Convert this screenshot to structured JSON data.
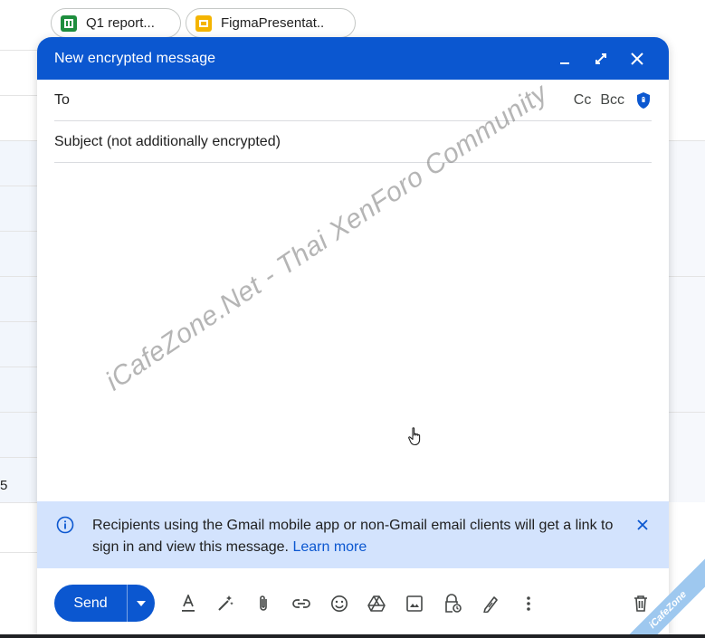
{
  "attachments": [
    {
      "name": "Q1 report...",
      "icon": "sheets-icon"
    },
    {
      "name": "FigmaPresentat..",
      "icon": "slides-icon"
    }
  ],
  "compose": {
    "title": "New encrypted message",
    "to_label": "To",
    "cc_label": "Cc",
    "bcc_label": "Bcc",
    "subject_placeholder": "Subject (not additionally encrypted)"
  },
  "watermark": "iCafeZone.Net - Thai XenForo Community",
  "info_banner": {
    "text": "Recipients using the Gmail mobile app or non-Gmail email clients will get a link to sign in and view this message.",
    "link": "Learn more"
  },
  "toolbar": {
    "send_label": "Send"
  },
  "background": {
    "partial_number": "5"
  },
  "corner_badge": "iCafeZone",
  "colors": {
    "accent": "#0b57d0",
    "banner": "#d3e3fd"
  }
}
